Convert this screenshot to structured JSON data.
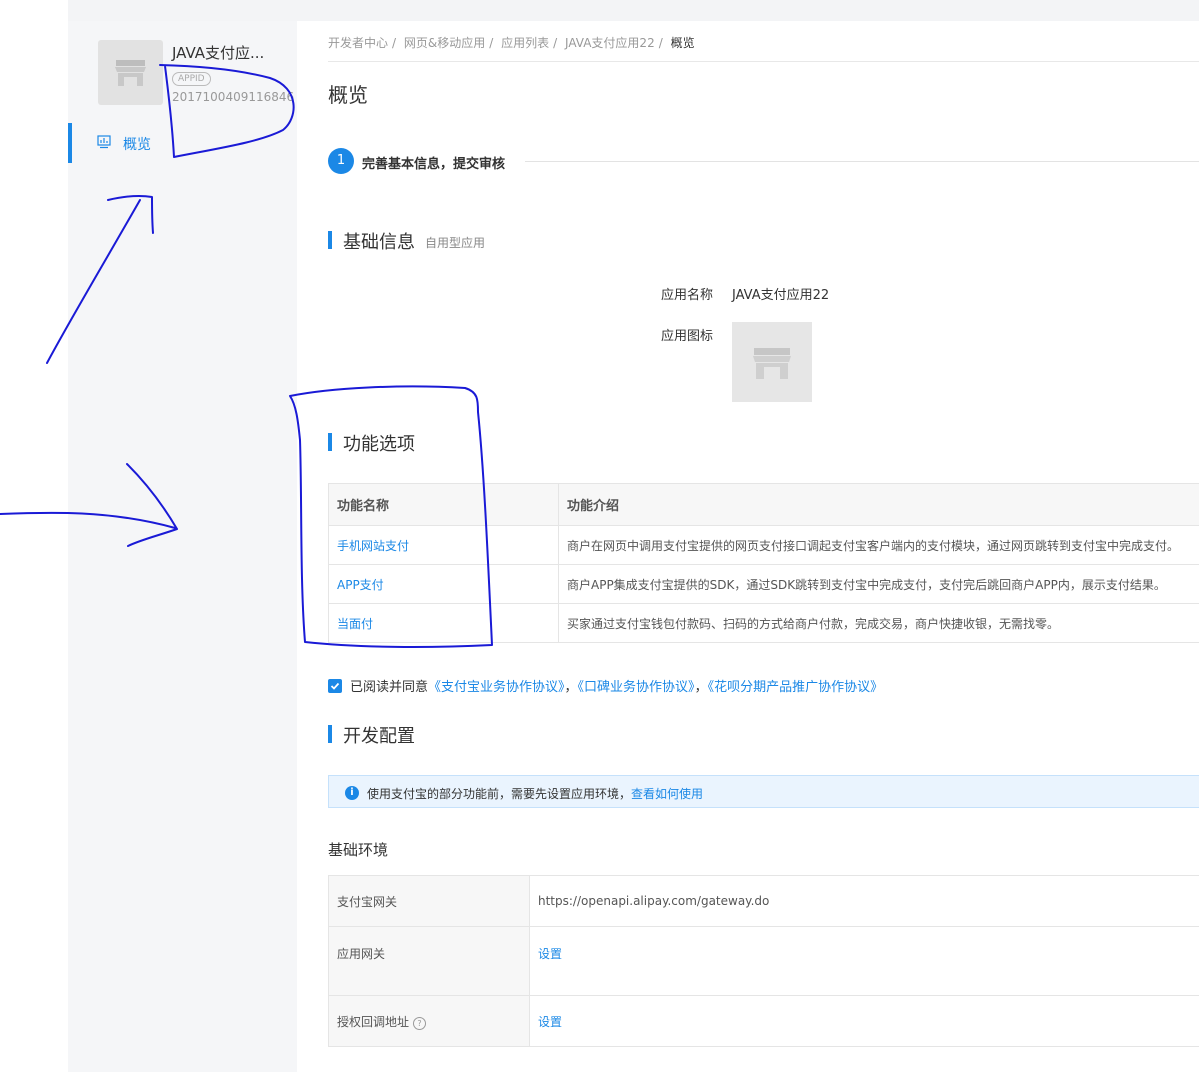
{
  "sidebar": {
    "app_name": "JAVA支付应...",
    "appid_badge": "APPID",
    "appid_value": "2017100409116846",
    "nav_active_label": "概览"
  },
  "breadcrumb": [
    "开发者中心",
    "网页&移动应用",
    "应用列表",
    "JAVA支付应用22",
    "概览"
  ],
  "page_title": "概览",
  "step": {
    "number": "1",
    "text": "完善基本信息，提交审核"
  },
  "basic_info": {
    "title": "基础信息",
    "subtitle": "自用型应用",
    "name_label": "应用名称",
    "name_value": "JAVA支付应用22",
    "icon_label": "应用图标"
  },
  "features": {
    "title": "功能选项",
    "headers": [
      "功能名称",
      "功能介绍"
    ],
    "rows": [
      {
        "name": "手机网站支付",
        "desc": "商户在网页中调用支付宝提供的网页支付接口调起支付宝客户端内的支付模块，通过网页跳转到支付宝中完成支付。"
      },
      {
        "name": "APP支付",
        "desc": "商户APP集成支付宝提供的SDK，通过SDK跳转到支付宝中完成支付，支付完后跳回商户APP内，展示支付结果。"
      },
      {
        "name": "当面付",
        "desc": "买家通过支付宝钱包付款码、扫码的方式给商户付款，完成交易，商户快捷收银，无需找零。"
      }
    ]
  },
  "agreement": {
    "prefix": "已阅读并同意",
    "link1": "《支付宝业务协作协议》",
    "sep1": "，",
    "link2": "《口碑业务协作协议》",
    "sep2": "，",
    "link3": "《花呗分期产品推广协作协议》",
    "checked": true
  },
  "dev_config": {
    "title": "开发配置",
    "info_text": "使用支付宝的部分功能前，需要先设置应用环境，",
    "info_link": "查看如何使用"
  },
  "env": {
    "title": "基础环境",
    "rows": [
      {
        "key": "支付宝网关",
        "value": "https://openapi.alipay.com/gateway.do"
      },
      {
        "key": "应用网关",
        "value": "设置"
      },
      {
        "key": "授权回调地址",
        "value": "设置"
      }
    ]
  },
  "colors": {
    "accent": "#1b88e6",
    "annotation_ink": "#1a1ad6"
  }
}
